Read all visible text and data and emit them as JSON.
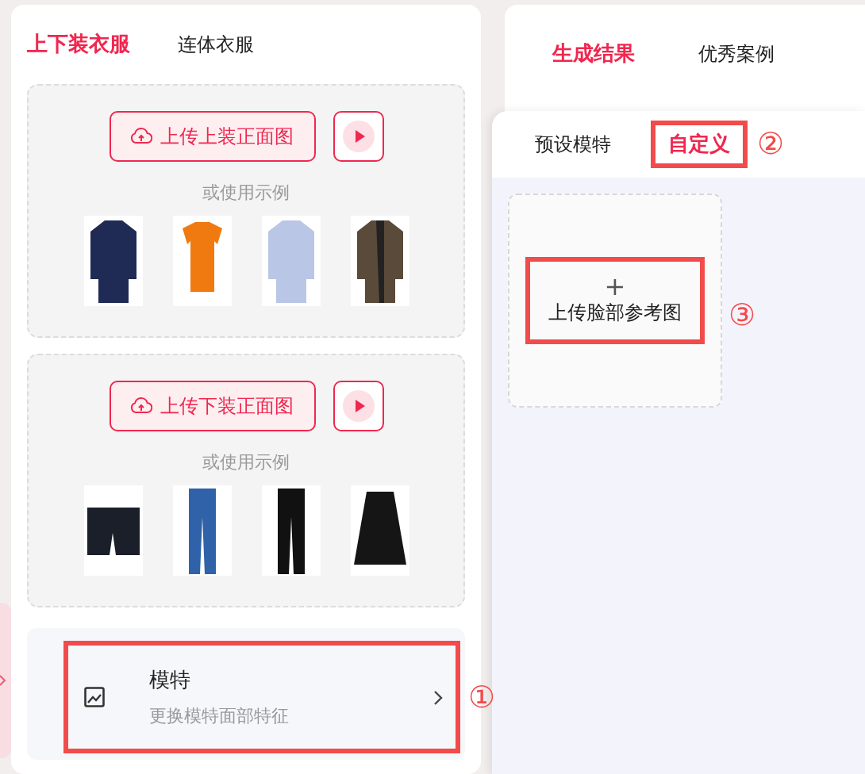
{
  "left_panel": {
    "tabs": [
      {
        "label": "上下装衣服",
        "selected": true
      },
      {
        "label": "连体衣服",
        "selected": false
      }
    ],
    "upload_sections": [
      {
        "button": "上传上装正面图",
        "hint": "或使用示例"
      },
      {
        "button": "上传下装正面图",
        "hint": "或使用示例"
      }
    ],
    "model_row": {
      "title": "模特",
      "subtitle": "更换模特面部特征",
      "highlighted": true,
      "marker": "①"
    }
  },
  "right_panel": {
    "tabs": [
      {
        "label": "生成结果",
        "selected": true
      },
      {
        "label": "优秀案例",
        "selected": false
      }
    ]
  },
  "popup": {
    "tabs": [
      {
        "label": "预设模特",
        "selected": false,
        "highlighted": false
      },
      {
        "label": "自定义",
        "selected": true,
        "highlighted": true
      }
    ],
    "tab_marker": "②",
    "upload_tile": {
      "plus": "+",
      "label": "上传脸部参考图",
      "highlighted": true,
      "marker": "③"
    }
  }
}
